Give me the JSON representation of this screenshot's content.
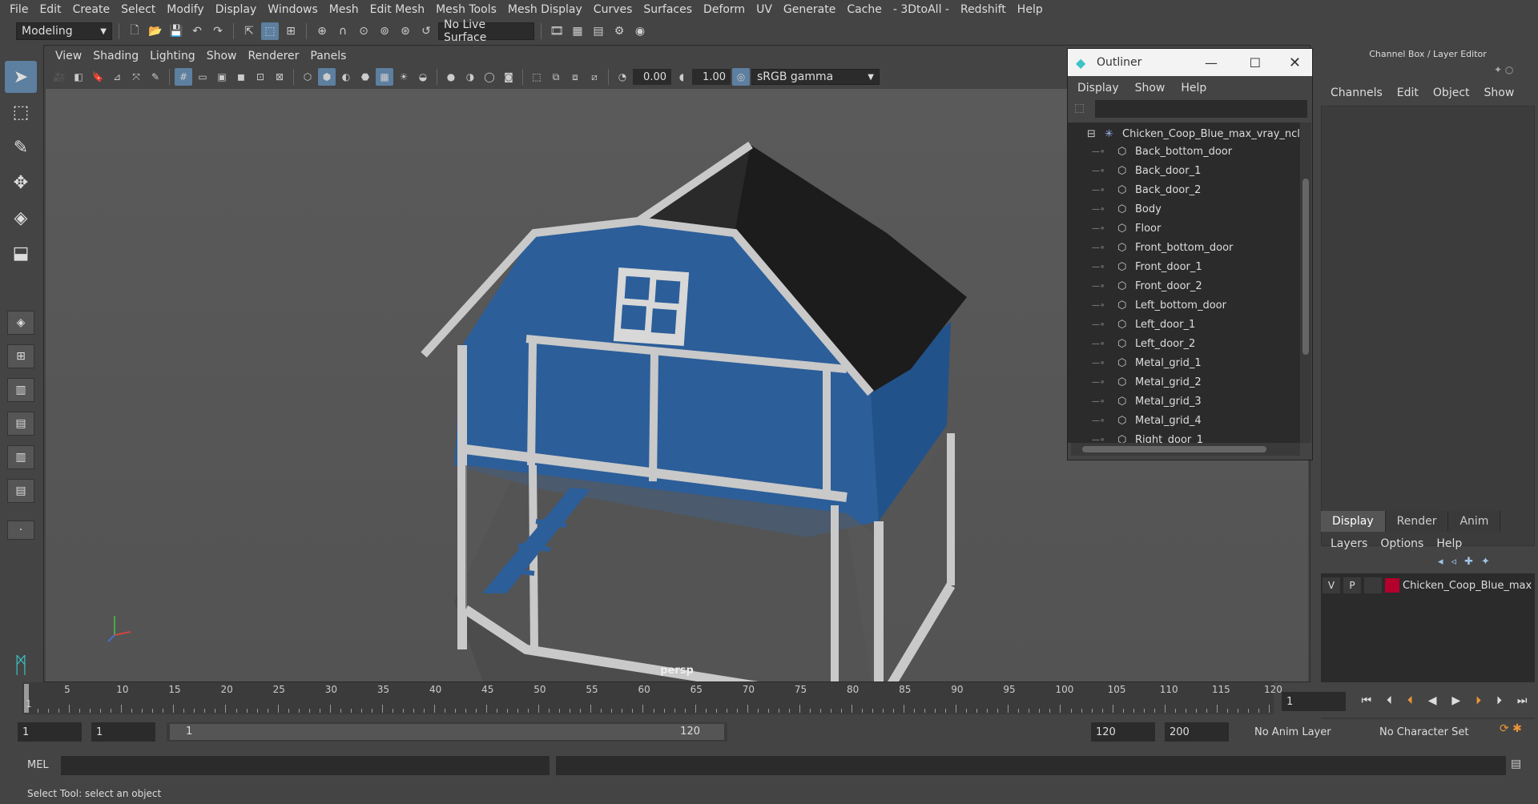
{
  "menubar": {
    "items": [
      "File",
      "Edit",
      "Create",
      "Select",
      "Modify",
      "Display",
      "Windows",
      "Mesh",
      "Edit Mesh",
      "Mesh Tools",
      "Mesh Display",
      "Curves",
      "Surfaces",
      "Deform",
      "UV",
      "Generate",
      "Cache",
      "- 3DtoAll -",
      "Redshift",
      "Help"
    ]
  },
  "statusline": {
    "mode": "Modeling",
    "live_surface": "No Live Surface"
  },
  "viewport": {
    "menu": [
      "View",
      "Shading",
      "Lighting",
      "Show",
      "Renderer",
      "Panels"
    ],
    "exposure": "0.00",
    "gamma": "1.00",
    "color_space": "sRGB gamma",
    "camera_label": "persp"
  },
  "outliner": {
    "title": "Outliner",
    "menu": [
      "Display",
      "Show",
      "Help"
    ],
    "root": "Chicken_Coop_Blue_max_vray_ncl",
    "children": [
      "Back_bottom_door",
      "Back_door_1",
      "Back_door_2",
      "Body",
      "Floor",
      "Front_bottom_door",
      "Front_door_1",
      "Front_door_2",
      "Left_bottom_door",
      "Left_door_1",
      "Left_door_2",
      "Metal_grid_1",
      "Metal_grid_2",
      "Metal_grid_3",
      "Metal_grid_4",
      "Right_door_1"
    ]
  },
  "channelbox": {
    "title": "Channel Box / Layer Editor",
    "menu": [
      "Channels",
      "Edit",
      "Object",
      "Show"
    ],
    "tabs": [
      "Display",
      "Render",
      "Anim"
    ],
    "layer_menu": [
      "Layers",
      "Options",
      "Help"
    ],
    "layer": {
      "v": "V",
      "p": "P",
      "name": "Chicken_Coop_Blue_max",
      "color": "#b3002d"
    }
  },
  "timeslider": {
    "ticks": [
      "5",
      "10",
      "15",
      "20",
      "25",
      "30",
      "35",
      "40",
      "45",
      "50",
      "55",
      "60",
      "65",
      "70",
      "75",
      "80",
      "85",
      "90",
      "95",
      "100",
      "105",
      "110",
      "115",
      "120"
    ],
    "current_frame_marker": "1",
    "current_frame_field": "1"
  },
  "range": {
    "start": "1",
    "playback_start": "1",
    "slider_start": "1",
    "slider_end": "120",
    "playback_end": "120",
    "end": "200",
    "anim_layer": "No Anim Layer",
    "character_set": "No Character Set"
  },
  "cmdline": {
    "label": "MEL"
  },
  "helpline": {
    "text": "Select Tool: select an object"
  }
}
